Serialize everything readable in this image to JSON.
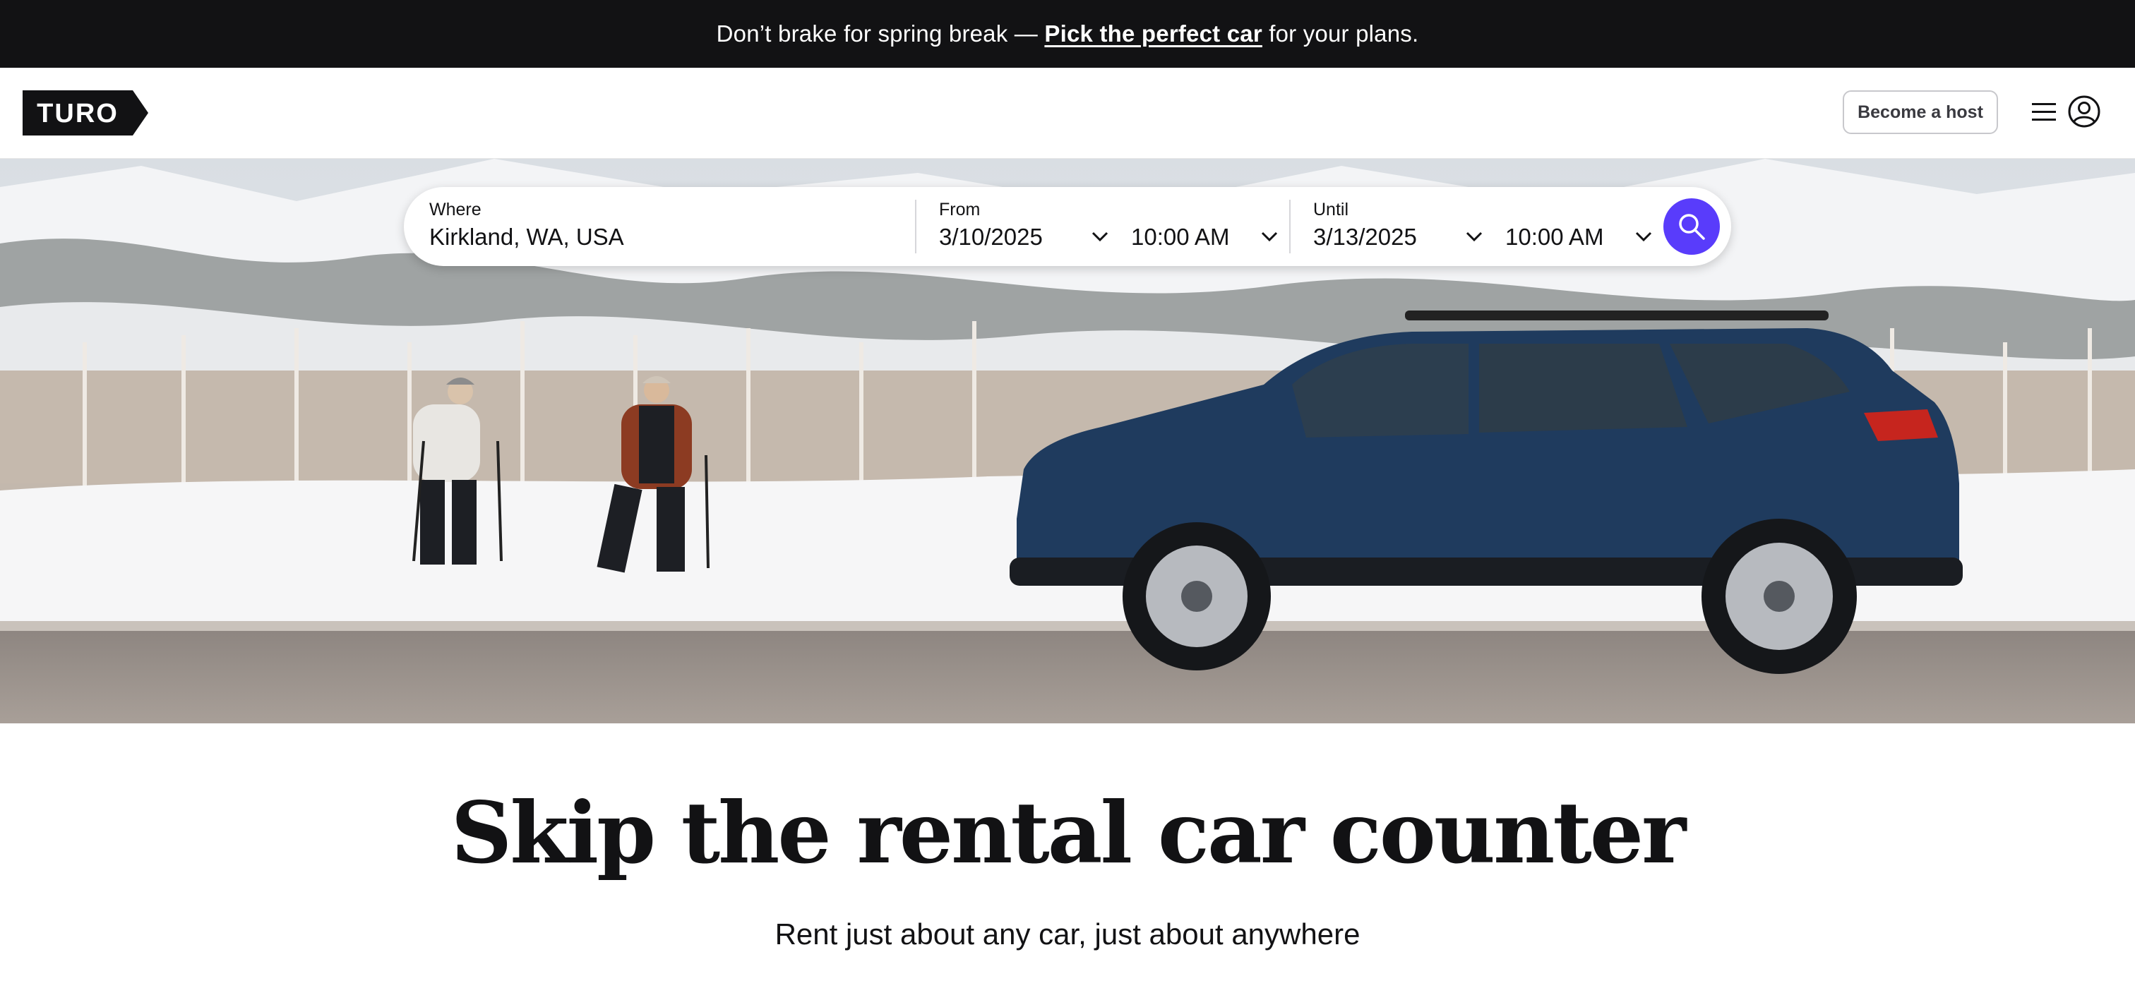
{
  "promo": {
    "text_before": "Don’t brake for spring break — ",
    "link": "Pick the perfect car",
    "text_after": " for your plans."
  },
  "header": {
    "logo": "TURO",
    "become_host": "Become a host",
    "menu_icon": "hamburger-icon",
    "account_icon": "user-circle-icon"
  },
  "search": {
    "where_label": "Where",
    "where_value": "Kirkland, WA, USA",
    "from_label": "From",
    "from_date": "3/10/2025",
    "from_time": "10:00 AM",
    "until_label": "Until",
    "until_date": "3/13/2025",
    "until_time": "10:00 AM",
    "search_icon": "search-icon"
  },
  "main": {
    "headline": "Skip the rental car counter",
    "subhead": "Rent just about any car, just about anywhere"
  },
  "colors": {
    "promo_bg": "#121214",
    "accent": "#593cfb"
  }
}
